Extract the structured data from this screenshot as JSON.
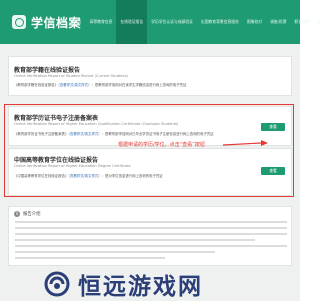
{
  "app": {
    "logo_text": "学信档案"
  },
  "nav": [
    "首页",
    "高等教育信息",
    "在线验证报告",
    "学历学位认证与成绩验证",
    "出国教育背景信息服务",
    "图像校对",
    "调查/投票",
    "职业测评",
    "就业"
  ],
  "nav_active_index": 2,
  "cards": [
    {
      "title": "教育部学籍在线验证报告",
      "subtitle": "Online Verification Report of Student Record (Current Students)",
      "desc_prefix": "《教育部学籍在线验证报告》（",
      "desc_link": "查看样式/英文样式",
      "desc_suffix": "）：是教育部学信网对在读学生学籍信息进行网上查询的电子凭证",
      "button": ""
    },
    {
      "title": "教育部学历证书电子注册备案表",
      "subtitle": "Online Verification Report of Higher Education Qualification Certificate (Graduate Students)",
      "desc_prefix": "《教育部学历证书电子注册备案表》（",
      "desc_link": "查看样式/英文样式",
      "desc_suffix": "）：是教育部学信网对已毕业学历证书电子注册信息进行网上查询的电子凭证",
      "button": "查看"
    },
    {
      "title": "中国高等教育学位在线验证报告",
      "subtitle": "Online Verification Report of Higher Education Degree Certificate",
      "desc_prefix": "《中国高等教育学位在线验证报告》（",
      "desc_link": "查看样式/英文样式",
      "desc_suffix": "）：是对学位信息进行网上查询的电子凭证",
      "button": "查看"
    }
  ],
  "callout": "根据申请的学历/学位，点击“查看”按钮",
  "help": {
    "title": "报告介绍"
  },
  "watermark": {
    "text": "恒远游戏网"
  },
  "colors": {
    "brand": "#1f9b73",
    "highlight": "#e53935",
    "watermark": "#2c3e77"
  }
}
